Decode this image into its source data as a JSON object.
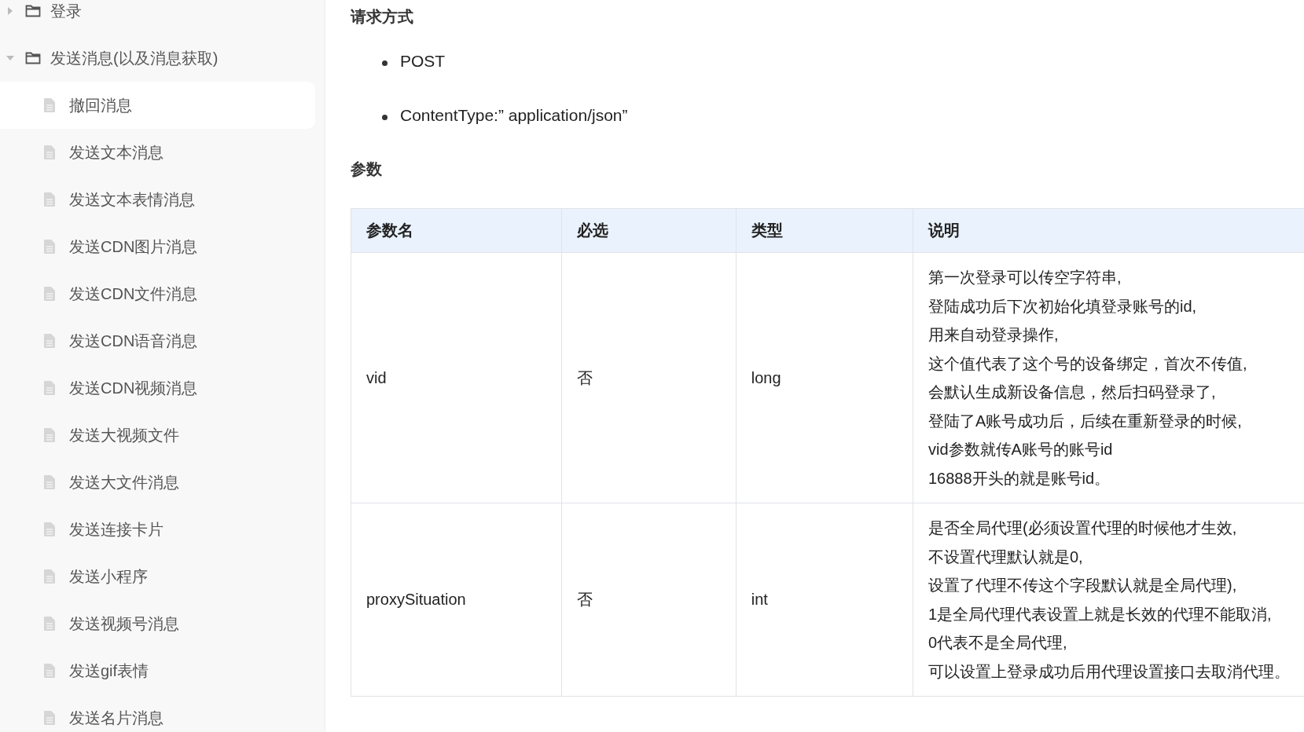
{
  "sidebar": {
    "items": [
      {
        "label": "登录",
        "expanded": false
      },
      {
        "label": "发送消息(以及消息获取)",
        "expanded": true,
        "children": [
          {
            "label": "撤回消息",
            "selected": true
          },
          {
            "label": "发送文本消息",
            "selected": false
          },
          {
            "label": "发送文本表情消息",
            "selected": false
          },
          {
            "label": "发送CDN图片消息",
            "selected": false
          },
          {
            "label": "发送CDN文件消息",
            "selected": false
          },
          {
            "label": "发送CDN语音消息",
            "selected": false
          },
          {
            "label": "发送CDN视频消息",
            "selected": false
          },
          {
            "label": "发送大视频文件",
            "selected": false
          },
          {
            "label": "发送大文件消息",
            "selected": false
          },
          {
            "label": "发送连接卡片",
            "selected": false
          },
          {
            "label": "发送小程序",
            "selected": false
          },
          {
            "label": "发送视频号消息",
            "selected": false
          },
          {
            "label": "发送gif表情",
            "selected": false
          },
          {
            "label": "发送名片消息",
            "selected": false
          }
        ]
      }
    ]
  },
  "content": {
    "request_heading": "请求方式",
    "request_items": [
      "POST",
      "ContentType:” application/json”"
    ],
    "params_heading": "参数",
    "table": {
      "columns": [
        "参数名",
        "必选",
        "类型",
        "说明"
      ],
      "rows": [
        {
          "name": "vid",
          "required": "否",
          "type": "long",
          "description": [
            "第一次登录可以传空字符串,",
            "登陆成功后下次初始化填登录账号的id,",
            "用来自动登录操作,",
            "这个值代表了这个号的设备绑定，首次不传值,",
            "会默认生成新设备信息，然后扫码登录了,",
            "登陆了A账号成功后，后续在重新登录的时候,",
            "vid参数就传A账号的账号id",
            "16888开头的就是账号id。"
          ]
        },
        {
          "name": "proxySituation",
          "required": "否",
          "type": "int",
          "description": [
            "是否全局代理(必须设置代理的时候他才生效,",
            "不设置代理默认就是0,",
            "设置了代理不传这个字段默认就是全局代理),",
            "1是全局代理代表设置上就是长效的代理不能取消,",
            "0代表不是全局代理,",
            "可以设置上登录成功后用代理设置接口去取消代理。"
          ]
        }
      ]
    }
  }
}
